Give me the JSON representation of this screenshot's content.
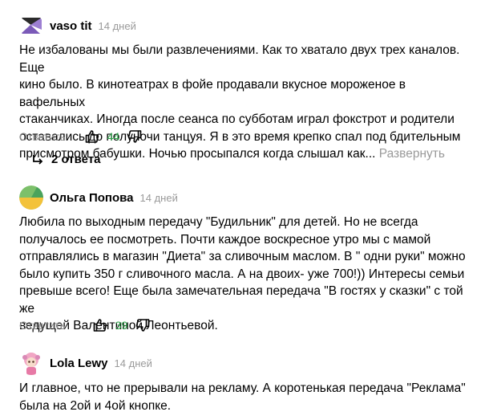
{
  "comments": [
    {
      "author": "vaso tit",
      "date": "14 дней",
      "text_lines": [
        "Не избалованы мы были развлечениями. Как то хватало двух трех каналов. Еще",
        "кино было. В кинотеатрах в фойе продавали вкусное мороженое в вафельных",
        "стаканчиках. Иногда после сеанса по субботам играл фокстрот и родители",
        "оставались до полуночи танцуя. Я в это время крепко спал под бдительным",
        "присмотром бабушки. Ночью просыпался когда слышал как..."
      ],
      "expand_label": "Развернуть",
      "reply_label": "Ответить",
      "likes": "44",
      "replies_label": "2 ответа"
    },
    {
      "author": "Ольга Попова",
      "date": "14 дней",
      "text_lines": [
        "Любила по выходным передачу \"Будильник\" для детей. Но не всегда",
        "получалось ее посмотреть. Почти каждое воскресное утро мы с мамой",
        "отправлялись в магазин \"Диета\" за сливочным маслом. В \" одни руки\" можно",
        "было купить 350 г сливочного масла. А на двоих- уже 700!)) Интересы семьи",
        "превыше всего! Еще была замечательная передача \"В гостях у сказки\" с той же",
        "ведущей Валентиной Леонтьевой."
      ],
      "reply_label": "Ответить",
      "likes": "39"
    },
    {
      "author": "Lola Lewy",
      "date": "14 дней",
      "text_lines": [
        "И главное, что не прерывали на рекламу. А коротенькая передача \"Реклама\"",
        "была на 2ой и 4ой кнопке."
      ]
    }
  ],
  "colors": {
    "likes_green": "#2fa44b",
    "meta_gray": "#9a9a9a"
  }
}
